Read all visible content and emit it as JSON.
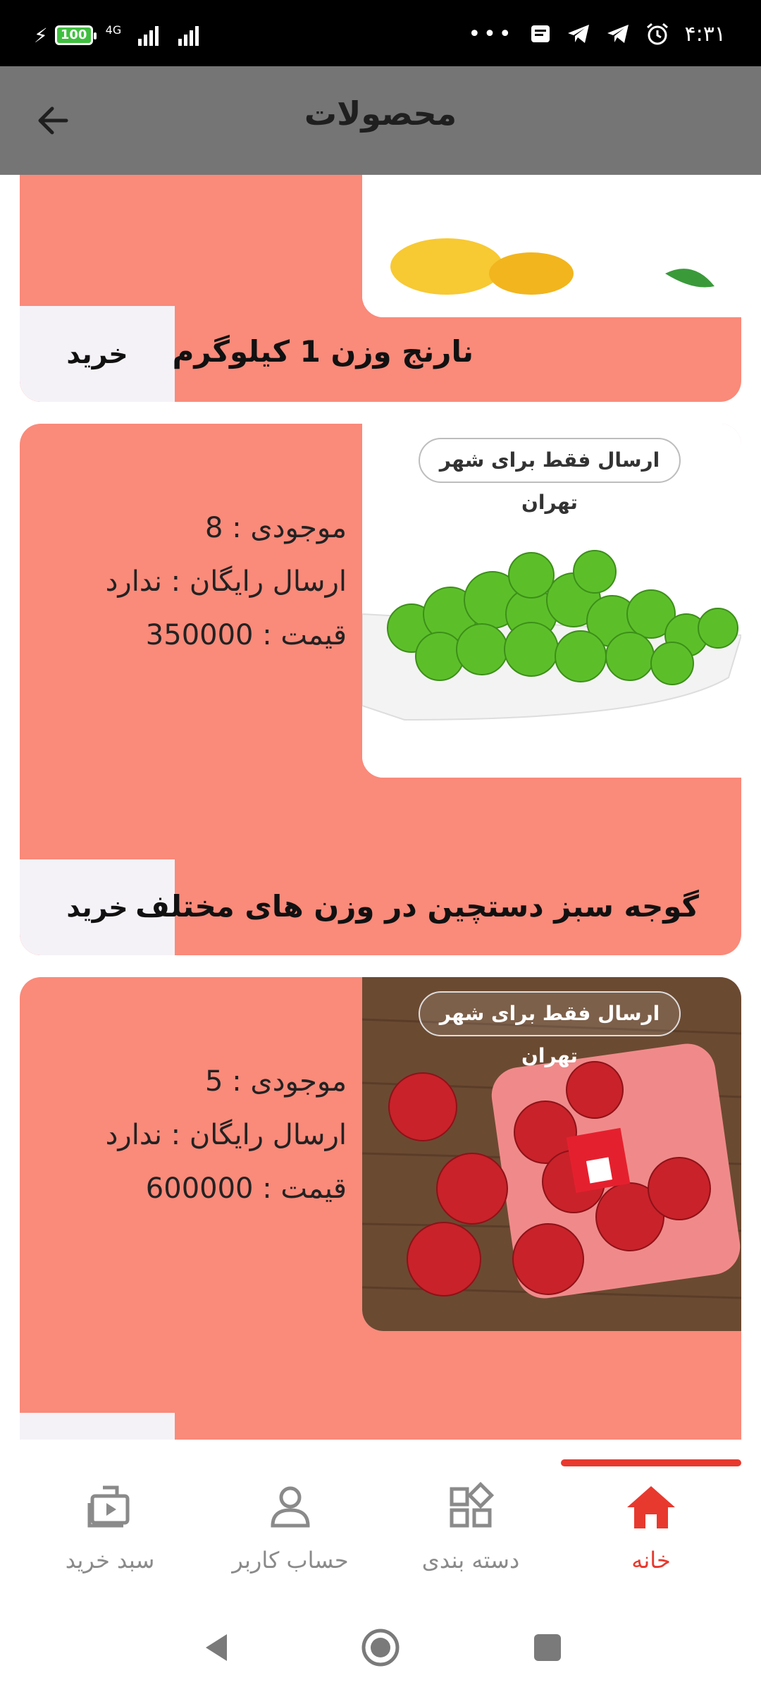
{
  "status_bar": {
    "battery": "100",
    "network": "4G",
    "time": "۴:۳۱"
  },
  "app_bar": {
    "title": "محصولات"
  },
  "products": [
    {
      "name": "نارنج وزن 1 کیلوگرم",
      "buy_label": "خرید"
    },
    {
      "name": "گوجه سبز دستچین در وزن های مختلف",
      "badge": "ارسال فقط برای شهر تهران",
      "stock": "موجودی : 8",
      "free_shipping": "ارسال رایگان : ندارد",
      "price": "قیمت : 350000",
      "buy_label": "خرید"
    },
    {
      "badge": "ارسال فقط برای شهر تهران",
      "stock": "موجودی : 5",
      "free_shipping": "ارسال رایگان : ندارد",
      "price": "قیمت : 600000"
    }
  ],
  "bottom_nav": {
    "items": [
      {
        "label": "خانه",
        "icon": "home-icon",
        "active": true
      },
      {
        "label": "دسته بندی",
        "icon": "category-icon",
        "active": false
      },
      {
        "label": "حساب کاربر",
        "icon": "user-icon",
        "active": false
      },
      {
        "label": "سبد خرید",
        "icon": "cart-icon",
        "active": false
      }
    ]
  },
  "colors": {
    "card": "#fa8a7a",
    "accent": "#e8392e",
    "app_bar": "#757575"
  }
}
